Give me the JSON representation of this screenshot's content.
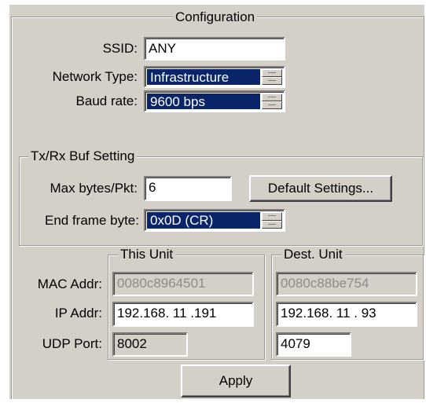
{
  "configuration": {
    "title": "Configuration",
    "ssid": {
      "label": "SSID:",
      "value": "ANY"
    },
    "network_type": {
      "label": "Network Type:",
      "value": "Infrastructure"
    },
    "baud_rate": {
      "label": "Baud rate:",
      "value": "9600 bps"
    }
  },
  "txrx": {
    "title": "Tx/Rx Buf Setting",
    "max_bytes": {
      "label": "Max bytes/Pkt:",
      "value": "6"
    },
    "default_settings_label": "Default Settings...",
    "end_frame": {
      "label": "End frame byte:",
      "value": "0x0D (CR)"
    }
  },
  "rows": {
    "mac_label": "MAC Addr:",
    "ip_label": "IP Addr:",
    "udp_label": "UDP Port:"
  },
  "this_unit": {
    "title": "This Unit",
    "mac": "0080c8964501",
    "ip": "192.168. 11 .191",
    "udp": "8002"
  },
  "dest_unit": {
    "title": "Dest. Unit",
    "mac": "0080c88be754",
    "ip": "192.168. 11 . 93",
    "udp": "4079"
  },
  "apply_label": "Apply",
  "colors": {
    "panel": "#d4d0c8",
    "selection": "#0a246a",
    "disabled_text": "#8c8c8c"
  }
}
